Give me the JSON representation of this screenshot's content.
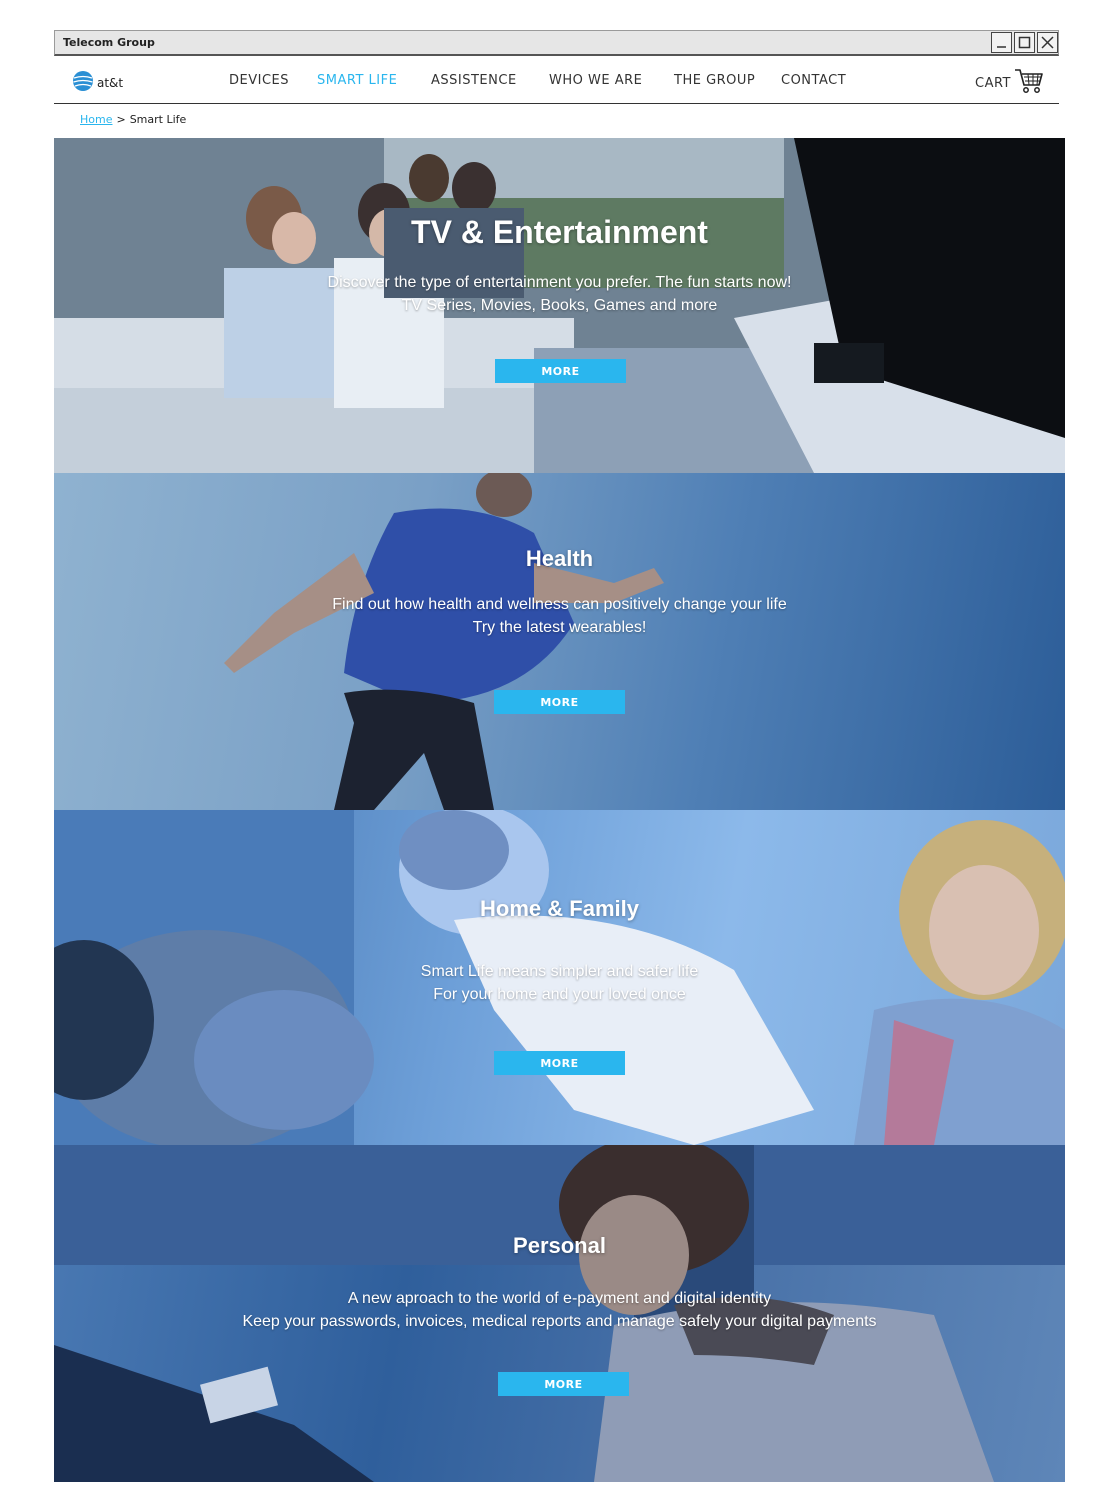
{
  "window": {
    "title": "Telecom Group",
    "buttons": [
      "minimize-icon",
      "maximize-icon",
      "close-icon"
    ]
  },
  "logo": {
    "text": "at&t",
    "icon": "att-globe-icon"
  },
  "nav": {
    "items": [
      {
        "label": "DEVICES",
        "active": false
      },
      {
        "label": "SMART LIFE",
        "active": true
      },
      {
        "label": "ASSISTENCE",
        "active": false
      },
      {
        "label": "WHO WE ARE",
        "active": false
      },
      {
        "label": "THE GROUP",
        "active": false
      },
      {
        "label": "CONTACT",
        "active": false
      }
    ],
    "cart_label": "CART",
    "cart_icon": "shopping-cart-icon"
  },
  "breadcrumb": {
    "home": "Home",
    "separator": ">",
    "current": "Smart Life"
  },
  "sections": [
    {
      "title": "TV & Entertainment",
      "line1": "Discover the type of entertainment you prefer. The fun starts now!",
      "line2": "TV Series, Movies, Books, Games and more",
      "button": "MORE"
    },
    {
      "title": "Health",
      "line1": "Find out how health and wellness can positively change your life",
      "line2": "Try the latest wearables!",
      "button": "MORE"
    },
    {
      "title": "Home & Family",
      "line1": "Smart Life means simpler and safer life",
      "line2": "For your home and your loved once",
      "button": "MORE"
    },
    {
      "title": "Personal",
      "line1": "A new aproach to the world of e-payment and digital identity",
      "line2": "Keep your passwords, invoices, medical reports and manage safely your digital payments",
      "button": "MORE"
    }
  ],
  "colors": {
    "accent": "#2ab6ee",
    "nav_text": "#333333",
    "overlay_blue": "#4f7fb5"
  }
}
